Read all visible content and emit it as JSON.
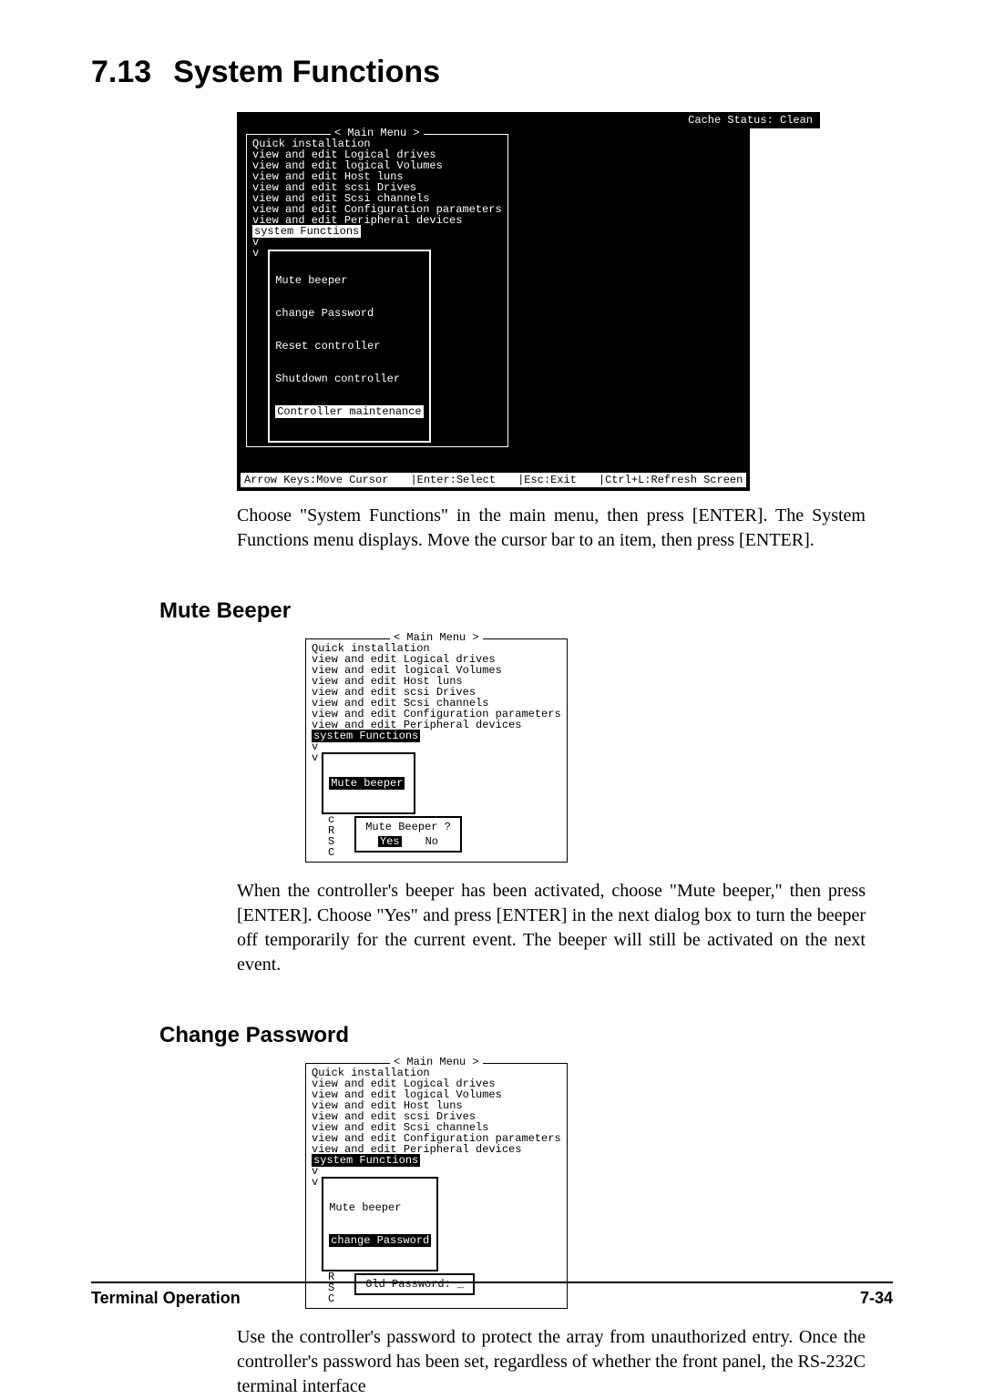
{
  "section": {
    "number": "7.13",
    "title": "System Functions"
  },
  "fig1": {
    "cache_status": "Cache Status: Clean",
    "menu_title": "< Main Menu >",
    "items": [
      "Quick installation",
      "view and edit Logical drives",
      "view and edit logical Volumes",
      "view and edit Host luns",
      "view and edit scsi Drives",
      "view and edit Scsi channels",
      "view and edit Configuration parameters",
      "view and edit Peripheral devices"
    ],
    "selected": "system Functions",
    "tail": [
      "v",
      "v"
    ],
    "submenu": [
      "Mute beeper",
      "change Password",
      "Reset controller",
      "Shutdown controller"
    ],
    "submenu_selected": "Controller maintenance",
    "statusbar": {
      "a": "Arrow Keys:Move Cursor",
      "b": "|Enter:Select",
      "c": "|Esc:Exit",
      "d": "|Ctrl+L:Refresh Screen"
    }
  },
  "para1": "Choose \"System Functions\" in the main menu, then press [ENTER]. The System Functions menu displays.  Move the cursor bar to an item, then press [ENTER].",
  "h_mute": "Mute Beeper",
  "fig2": {
    "menu_title": "< Main Menu >",
    "items": [
      "Quick installation",
      "view and edit Logical drives",
      "view and edit logical Volumes",
      "view and edit Host luns",
      "view and edit scsi Drives",
      "view and edit Scsi channels",
      "view and edit Configuration parameters",
      "view and edit Peripheral devices"
    ],
    "selected": "system Functions",
    "tail": [
      "v",
      "v"
    ],
    "submenu_selected": "Mute beeper",
    "side_letters": [
      "c",
      "R",
      "S",
      "C"
    ],
    "dialog_q": "Mute Beeper ?",
    "dialog_yes": "Yes",
    "dialog_no": "No"
  },
  "para2": "When the controller's beeper has been activated, choose \"Mute beeper,\" then press [ENTER].  Choose \"Yes\" and press [ENTER] in the next dialog box to turn the beeper off temporarily for the current event.  The beeper will still be activated on the next event.",
  "h_pw": "Change Password",
  "fig3": {
    "menu_title": "< Main Menu >",
    "items": [
      "Quick installation",
      "view and edit Logical drives",
      "view and edit logical Volumes",
      "view and edit Host luns",
      "view and edit scsi Drives",
      "view and edit Scsi channels",
      "view and edit Configuration parameters",
      "view and edit Peripheral devices"
    ],
    "selected": "system Functions",
    "tail": [
      "v",
      "v"
    ],
    "submenu": [
      "Mute beeper"
    ],
    "submenu_selected": "change Password",
    "side_letters": [
      "R",
      "S",
      "C"
    ],
    "dialog_label": "Old Password: _"
  },
  "para3": "Use the controller's password to protect the array from unauthorized entry. Once the controller's password has been set, regardless of whether the front panel, the RS-232C terminal interface",
  "footer": {
    "left": "Terminal Operation",
    "right": "7-34"
  }
}
